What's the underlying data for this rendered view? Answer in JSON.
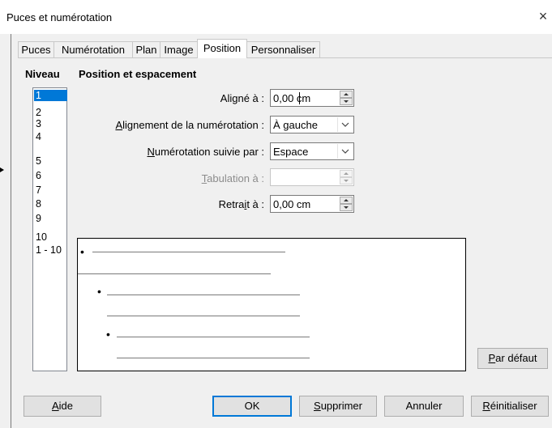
{
  "window": {
    "title": "Puces et numérotation",
    "close_glyph": "×"
  },
  "tabs": [
    {
      "label": "Puces",
      "active": false
    },
    {
      "label": "Numérotation",
      "active": false
    },
    {
      "label": "Plan",
      "active": false
    },
    {
      "label": "Image",
      "active": false
    },
    {
      "label": "Position",
      "active": true
    },
    {
      "label": "Personnaliser",
      "active": false
    }
  ],
  "level": {
    "heading": "Niveau",
    "items": [
      "1",
      "2",
      "3",
      "4",
      "5",
      "6",
      "7",
      "8",
      "9",
      "10",
      "1 - 10"
    ],
    "selected": "1"
  },
  "position": {
    "heading": "Position et espacement",
    "aligned_at": {
      "label_pre": "Ali",
      "label_key": "g",
      "label_post": "né à :",
      "value": "0,00 cm"
    },
    "numbering_alignment": {
      "label_key": "A",
      "label_post": "lignement de la numérotation :",
      "value": "À gauche"
    },
    "numbering_followed_by": {
      "label_key": "N",
      "label_post": "umérotation suivie par :",
      "value": "Espace"
    },
    "tab_stop_at": {
      "label_key": "T",
      "label_post": "abulation à :",
      "value": "",
      "disabled": true
    },
    "indent_at": {
      "label_pre": "Retra",
      "label_key": "i",
      "label_post": "t à :",
      "value": "0,00 cm"
    }
  },
  "preview": {
    "bullet": "•"
  },
  "buttons": {
    "default_key": "P",
    "default_rest": "ar défaut",
    "help_key": "A",
    "help_rest": "ide",
    "ok": "OK",
    "remove_key": "S",
    "remove_rest": "upprimer",
    "cancel": "Annuler",
    "reset_key": "R",
    "reset_rest": "éinitialiser"
  },
  "colors": {
    "selection": "#0078d7",
    "dialog_bg": "#f0f0f0"
  }
}
